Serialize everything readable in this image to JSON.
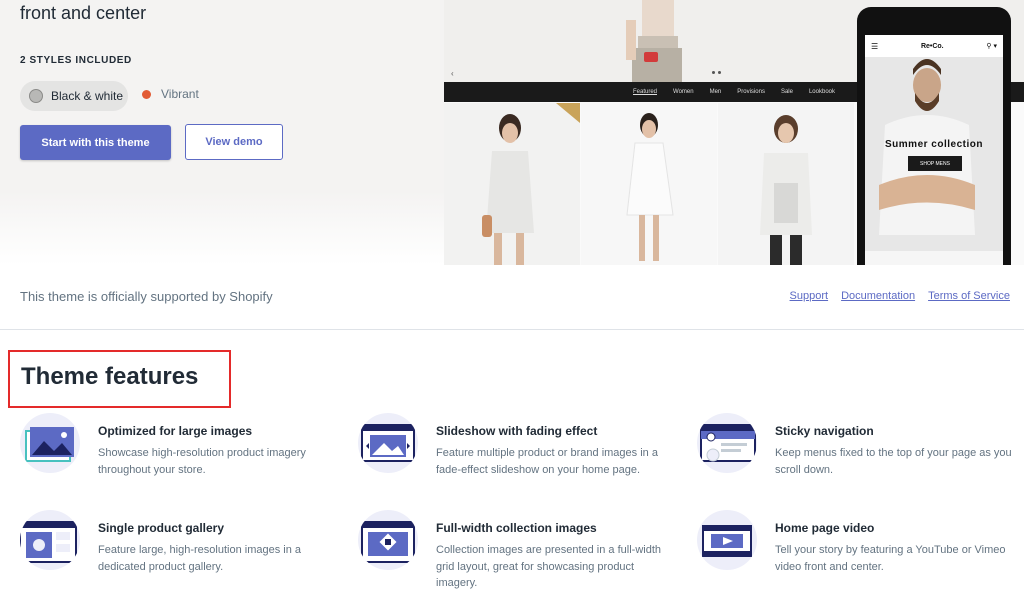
{
  "hero": {
    "tagline": "front and center",
    "styles_heading": "2 STYLES INCLUDED",
    "styles": [
      {
        "label": "Black & white",
        "selected": true,
        "color": "#b8b8b6"
      },
      {
        "label": "Vibrant",
        "selected": false,
        "color": "#e25b35"
      }
    ],
    "primary_button": "Start with this theme",
    "secondary_button": "View demo"
  },
  "preview": {
    "desktop_nav": [
      "Featured",
      "Women",
      "Men",
      "Provisions",
      "Sale",
      "Lookbook"
    ],
    "phone": {
      "logo": "Re•Co.",
      "heading": "Summer collection",
      "button": "SHOP MENS"
    }
  },
  "support": {
    "text": "This theme is officially supported by Shopify",
    "links": [
      "Support",
      "Documentation",
      "Terms of Service"
    ]
  },
  "features": {
    "title": "Theme features",
    "items": [
      {
        "title": "Optimized for large images",
        "description": "Showcase high-resolution product imagery throughout your store.",
        "icon": "image-icon"
      },
      {
        "title": "Slideshow with fading effect",
        "description": "Feature multiple product or brand images in a fade-effect slideshow on your home page.",
        "icon": "slideshow-icon"
      },
      {
        "title": "Sticky navigation",
        "description": "Keep menus fixed to the top of your page as you scroll down.",
        "icon": "sticky-nav-icon"
      },
      {
        "title": "Single product gallery",
        "description": "Feature large, high-resolution images in a dedicated product gallery.",
        "icon": "product-gallery-icon"
      },
      {
        "title": "Full-width collection images",
        "description": "Collection images are presented in a full-width grid layout, great for showcasing product imagery.",
        "icon": "collection-images-icon"
      },
      {
        "title": "Home page video",
        "description": "Tell your story by featuring a YouTube or Vimeo video front and center.",
        "icon": "video-icon"
      }
    ]
  },
  "colors": {
    "accent": "#5c6ac4",
    "highlight": "#e42a2a",
    "text": "#212b36",
    "muted": "#637381"
  }
}
